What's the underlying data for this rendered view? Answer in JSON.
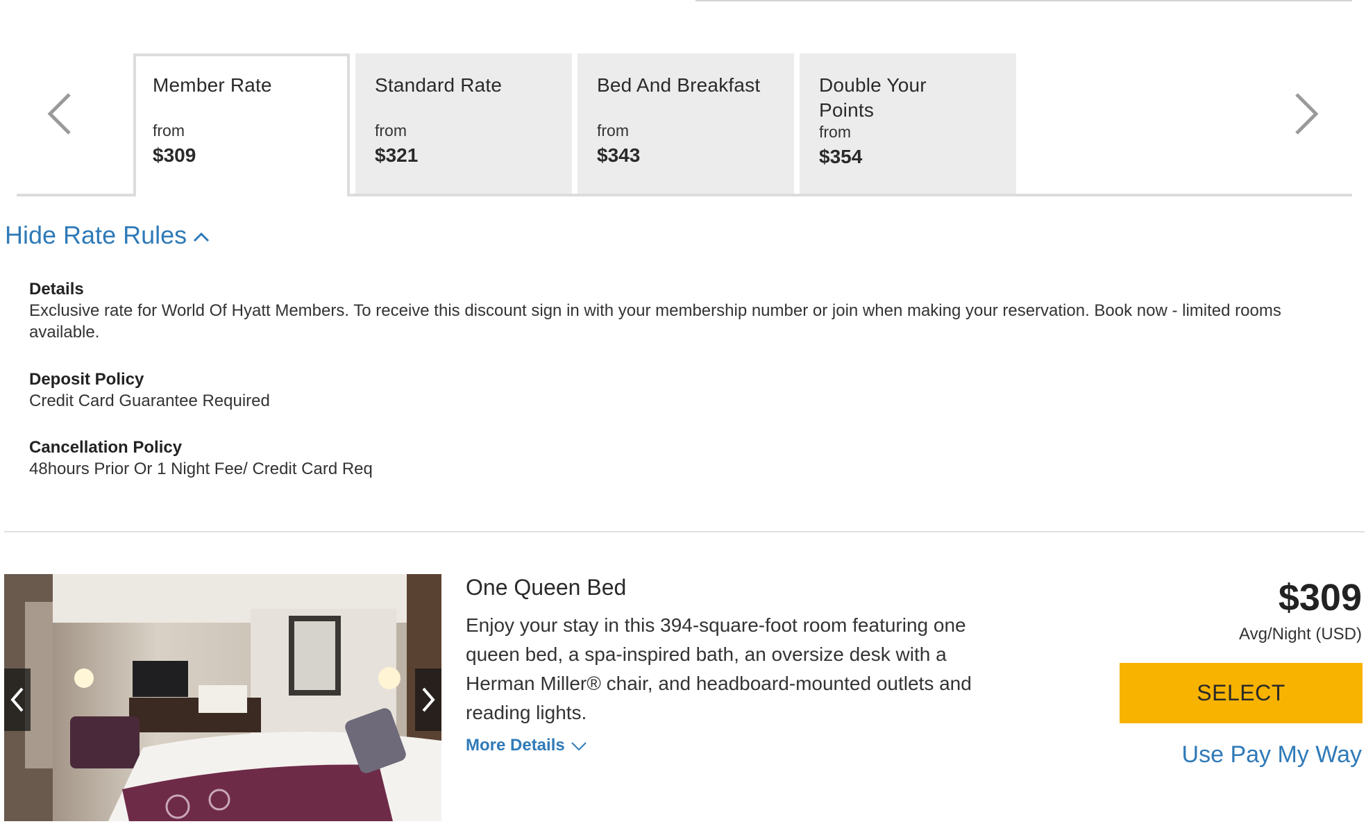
{
  "rate_tabs": [
    {
      "title": "Member Rate",
      "from_label": "from",
      "price": "$309",
      "active": true
    },
    {
      "title": "Standard Rate",
      "from_label": "from",
      "price": "$321",
      "active": false
    },
    {
      "title": "Bed And Breakfast",
      "from_label": "from",
      "price": "$343",
      "active": false
    },
    {
      "title": "Double Your Points",
      "from_label": "from",
      "price": "$354",
      "active": false
    }
  ],
  "icons": {
    "prev": "chevron-left-icon",
    "next": "chevron-right-icon",
    "hide_rules": "chevron-up-icon",
    "more_details": "chevron-down-icon"
  },
  "rate_rules": {
    "toggle_label": "Hide Rate Rules",
    "details_title": "Details",
    "details_text": "Exclusive rate for World Of Hyatt Members. To receive this discount sign in with your membership number or join when making your reservation. Book now - limited rooms available.",
    "deposit_title": "Deposit Policy",
    "deposit_text": "Credit Card Guarantee Required",
    "cancellation_title": "Cancellation Policy",
    "cancellation_text": "48hours Prior Or 1 Night Fee/ Credit Card Req"
  },
  "room": {
    "name": "One Queen Bed",
    "description": "Enjoy your stay in this 394-square-foot room featuring one queen bed, a spa-inspired bath, an oversize desk with a Herman Miller® chair, and headboard-mounted outlets and reading lights.",
    "more_details_label": "More Details",
    "price": "$309",
    "price_note": "Avg/Night (USD)",
    "select_label": "SELECT",
    "pay_my_way_label": "Use Pay My Way"
  },
  "colors": {
    "link_blue": "#2f7ab8",
    "select_yellow": "#f8b300",
    "tab_gray": "#ececec"
  }
}
